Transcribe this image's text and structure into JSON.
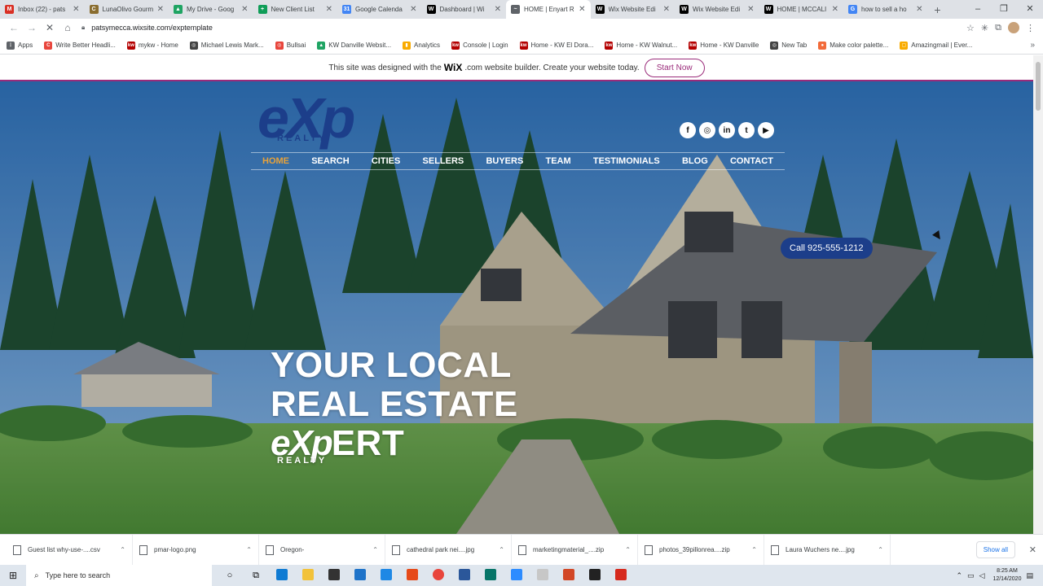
{
  "browser": {
    "tabs": [
      {
        "label": "Inbox (22) - pats",
        "icon": "gmail-icon",
        "color": "#d93025",
        "glyph": "M"
      },
      {
        "label": "LunaOlivo Gourm",
        "icon": "lunaolivo-icon",
        "color": "#8a6d2f",
        "glyph": "C"
      },
      {
        "label": "My Drive - Goog",
        "icon": "drive-icon",
        "color": "#1fa463",
        "glyph": "▲"
      },
      {
        "label": "New Client List",
        "icon": "sheets-icon",
        "color": "#0f9d58",
        "glyph": "+"
      },
      {
        "label": "Google Calenda",
        "icon": "calendar-icon",
        "color": "#4285f4",
        "glyph": "31"
      },
      {
        "label": "Dashboard | Wi",
        "icon": "wix-icon",
        "color": "#000000",
        "glyph": "W"
      },
      {
        "label": "HOME | Enyart R",
        "icon": "loading-icon",
        "color": "#5f6368",
        "glyph": "~",
        "active": true
      },
      {
        "label": "Wix Website Edi",
        "icon": "wix-icon",
        "color": "#000000",
        "glyph": "W"
      },
      {
        "label": "Wix Website Edi",
        "icon": "wix-icon",
        "color": "#000000",
        "glyph": "W"
      },
      {
        "label": "HOME | MCCALI",
        "icon": "wix-icon",
        "color": "#000000",
        "glyph": "W"
      },
      {
        "label": "how to sell a ho",
        "icon": "google-icon",
        "color": "#4285f4",
        "glyph": "G"
      }
    ],
    "url": "patsymecca.wixsite.com/exptemplate",
    "bookmarks": [
      {
        "label": "Apps",
        "color": "#5f6368",
        "glyph": "⋮"
      },
      {
        "label": "Write Better Headli...",
        "color": "#e8453c",
        "glyph": "C"
      },
      {
        "label": "mykw - Home",
        "color": "#b40101",
        "glyph": "kw"
      },
      {
        "label": "Michael Lewis Mark...",
        "color": "#444444",
        "glyph": "◎"
      },
      {
        "label": "Bullsai",
        "color": "#e8453c",
        "glyph": "◎"
      },
      {
        "label": "KW Danville Websit...",
        "color": "#1fa463",
        "glyph": "▲"
      },
      {
        "label": "Analytics",
        "color": "#f9ab00",
        "glyph": "▮"
      },
      {
        "label": "Console | Login",
        "color": "#b40101",
        "glyph": "kw"
      },
      {
        "label": "Home - KW El Dora...",
        "color": "#b40101",
        "glyph": "kw"
      },
      {
        "label": "Home - KW Walnut...",
        "color": "#b40101",
        "glyph": "kw"
      },
      {
        "label": "Home - KW Danville",
        "color": "#b40101",
        "glyph": "kw"
      },
      {
        "label": "New Tab",
        "color": "#444444",
        "glyph": "◎"
      },
      {
        "label": "Make color palette...",
        "color": "#f26b3a",
        "glyph": "●"
      },
      {
        "label": "Amazingmail | Ever...",
        "color": "#f9ab00",
        "glyph": "▢"
      }
    ]
  },
  "wix_banner": {
    "text_before": "This site was designed with the",
    "logo": "WiX",
    "text_after": ".com website builder. Create your website today.",
    "button": "Start Now"
  },
  "site": {
    "logo_main": "eXp",
    "logo_sub": "REALTY",
    "social": [
      {
        "icon": "facebook-icon",
        "glyph": "f"
      },
      {
        "icon": "instagram-icon",
        "glyph": "◎"
      },
      {
        "icon": "linkedin-icon",
        "glyph": "in"
      },
      {
        "icon": "twitter-icon",
        "glyph": "t"
      },
      {
        "icon": "youtube-icon",
        "glyph": "▶"
      }
    ],
    "nav": [
      "HOME",
      "SEARCH",
      "CITIES",
      "SELLERS",
      "BUYERS",
      "TEAM",
      "TESTIMONIALS",
      "BLOG",
      "CONTACT"
    ],
    "call_button": "Call 925-555-1212",
    "headline_line1": "YOUR LOCAL",
    "headline_line2": "REAL ESTATE",
    "headline_exp": "eXp",
    "headline_ert": "ERT",
    "headline_realty": "REALTY"
  },
  "downloads": {
    "items": [
      "Guest list why-use-....csv",
      "pmar-logo.png",
      "Oregon-",
      "cathedral park nei....jpg",
      "marketingmaterial_....zip",
      "photos_39pillonrea....zip",
      "Laura Wuchers ne....jpg"
    ],
    "show_all": "Show all"
  },
  "taskbar": {
    "search_placeholder": "Type here to search",
    "time": "8:25 AM",
    "date": "12/14/2020"
  }
}
